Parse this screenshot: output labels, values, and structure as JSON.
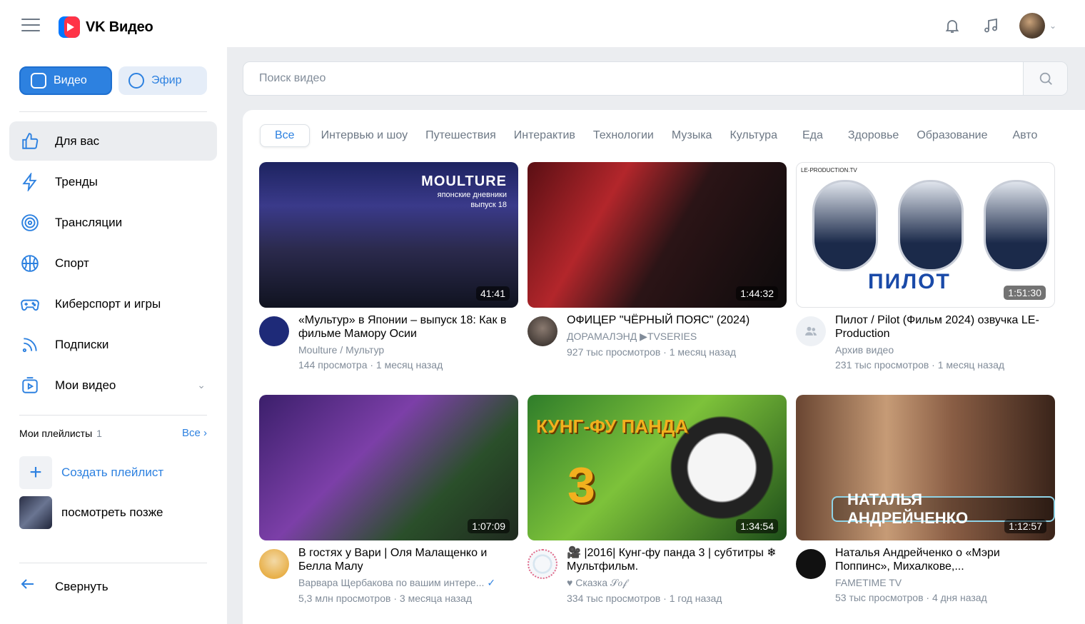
{
  "header": {
    "logo_text": "VK Видео"
  },
  "sidebar": {
    "top_tabs": [
      {
        "label": "Видео"
      },
      {
        "label": "Эфир"
      }
    ],
    "nav": [
      {
        "label": "Для вас",
        "icon": "thumbs-up-icon"
      },
      {
        "label": "Тренды",
        "icon": "lightning-icon"
      },
      {
        "label": "Трансляции",
        "icon": "broadcast-icon"
      },
      {
        "label": "Спорт",
        "icon": "ball-icon"
      },
      {
        "label": "Киберспорт и игры",
        "icon": "gamepad-icon"
      },
      {
        "label": "Подписки",
        "icon": "rss-icon"
      },
      {
        "label": "Мои видео",
        "icon": "video-folder-icon"
      }
    ],
    "playlists": {
      "title": "Мои плейлисты",
      "count": "1",
      "all_label": "Все",
      "create_label": "Создать плейлист",
      "items": [
        {
          "label": "посмотреть позже"
        }
      ]
    },
    "collapse_label": "Свернуть"
  },
  "search": {
    "placeholder": "Поиск видео"
  },
  "categories": [
    "Все",
    "Интервью и шоу",
    "Путешествия",
    "Интерактив",
    "Технологии",
    "Музыка",
    "Культура",
    "Еда",
    "Здоровье",
    "Образование",
    "Авто"
  ],
  "videos": [
    {
      "title": "«Мультур» в Японии – выпуск 18: Как в фильме Мамору Осии",
      "channel": "Moulture / Мультур",
      "stats": "144 просмотра · 1 месяц назад",
      "duration": "41:41",
      "overlay_big": "MOULTURE",
      "overlay_small_1": "японские дневники",
      "overlay_small_2": "выпуск 18"
    },
    {
      "title": "ОФИЦЕР \"ЧЁРНЫЙ ПОЯС\" (2024)",
      "channel": "ДОРАМАЛЭНД ▶TVSERIES",
      "stats": "927 тыс просмотров · 1 месяц назад",
      "duration": "1:44:32"
    },
    {
      "title": "Пилот / Pilot (Фильм 2024) озвучка LE-Production",
      "channel": "Архив видео",
      "stats": "231 тыс просмотров · 1 месяц назад",
      "duration": "1:51:30",
      "overlay_tag": "LE-PRODUCTION.TV",
      "overlay_big": "ПИЛОТ"
    },
    {
      "title": "В гостях у Вари | Оля Малащенко и Белла Малу",
      "channel": "Варвара Щербакова по вашим интере...",
      "stats": "5,3 млн просмотров · 3 месяца назад",
      "duration": "1:07:09"
    },
    {
      "title": "🎥 |2016| Кунг-фу панда 3 | субтитры ❄ Мультфильм.",
      "channel": "♥ Сказка 𝒮𝑜𝒻",
      "stats": "334 тыс просмотров · 1 год назад",
      "duration": "1:34:54",
      "overlay_big": "КУНГ-ФУ ПАНДА",
      "overlay_num": "3"
    },
    {
      "title": "Наталья Андрейченко о «Мэри Поппинс», Михалкове,...",
      "channel": "FAMETIME TV",
      "stats": "53 тыс просмотров · 4 дня назад",
      "duration": "1:12:57",
      "overlay_big": "НАТАЛЬЯ АНДРЕЙЧЕНКО"
    }
  ],
  "colors": {
    "accent": "#2d81e0",
    "sidebar_bg": "#ffffff",
    "page_bg": "#ebedf0"
  }
}
